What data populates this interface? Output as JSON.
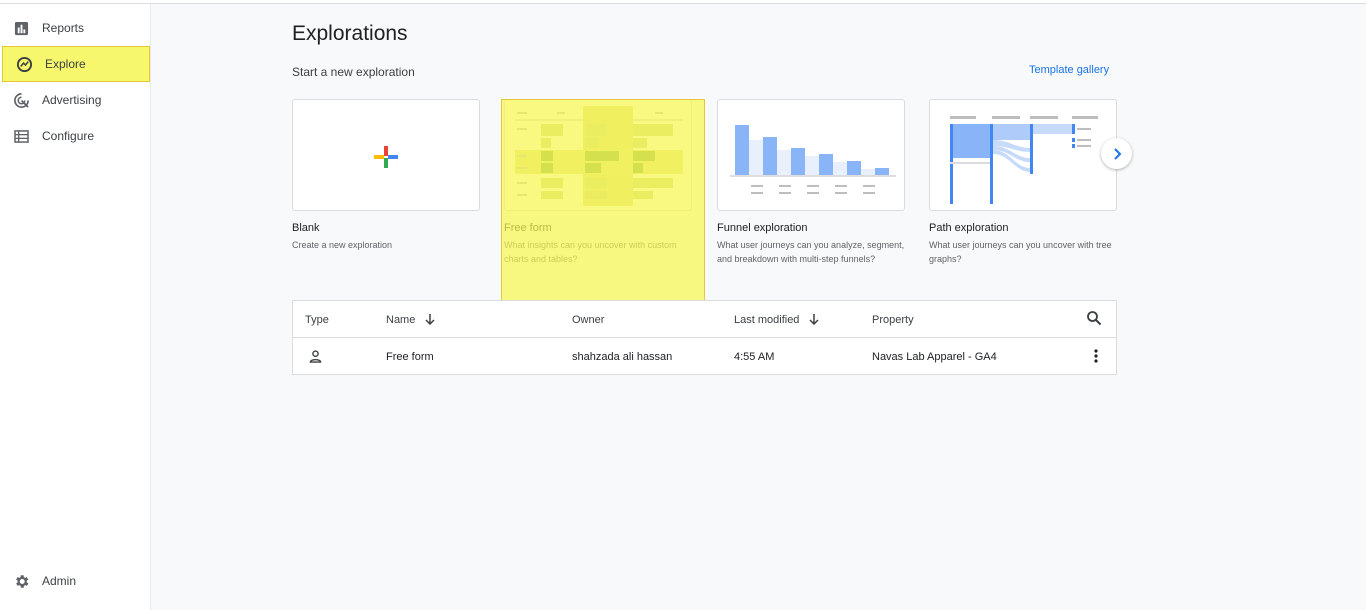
{
  "sidebar": {
    "items": [
      {
        "label": "Reports",
        "icon": "reports-icon"
      },
      {
        "label": "Explore",
        "icon": "explore-icon"
      },
      {
        "label": "Advertising",
        "icon": "advertising-icon"
      },
      {
        "label": "Configure",
        "icon": "configure-icon"
      }
    ],
    "admin_label": "Admin"
  },
  "main": {
    "title": "Explorations",
    "subtitle": "Start a new exploration",
    "template_gallery": "Template gallery",
    "cards": [
      {
        "title": "Blank",
        "desc": "Create a new exploration"
      },
      {
        "title": "Free form",
        "desc": "What insights can you uncover with custom charts and tables?"
      },
      {
        "title": "Funnel exploration",
        "desc": "What user journeys can you analyze, segment, and breakdown with multi-step funnels?"
      },
      {
        "title": "Path exploration",
        "desc": "What user journeys can you uncover with tree graphs?"
      }
    ]
  },
  "table": {
    "headers": {
      "type": "Type",
      "name": "Name",
      "owner": "Owner",
      "last_modified": "Last modified",
      "property": "Property"
    },
    "rows": [
      {
        "name": "Free form",
        "owner": "shahzada ali hassan",
        "last_modified": "4:55 AM",
        "property": "Navas Lab Apparel - GA4"
      }
    ]
  },
  "colors": {
    "accent": "#1a73e8",
    "highlight": "#f7f76e"
  }
}
